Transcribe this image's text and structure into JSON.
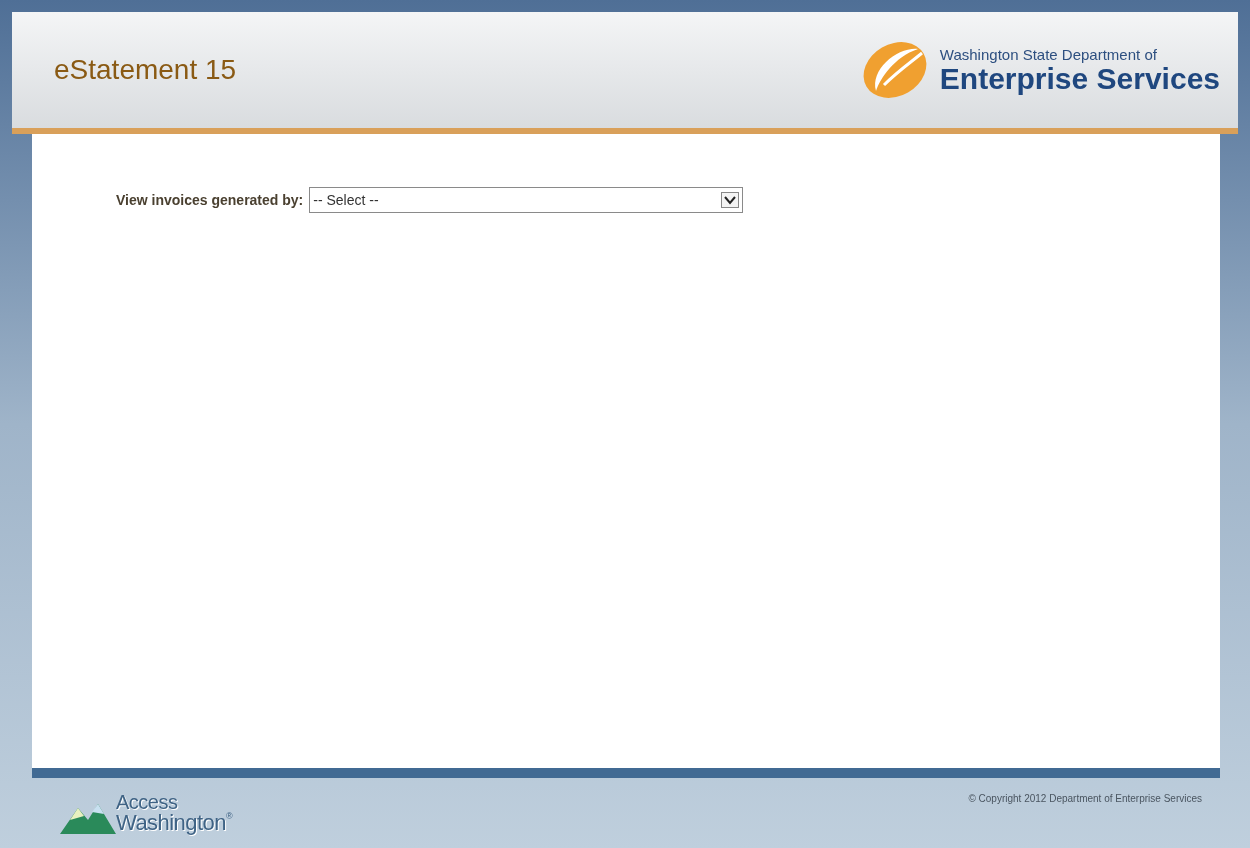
{
  "header": {
    "title": "eStatement 15",
    "logo": {
      "line_1": "Washington State Department of",
      "line_2": "Enterprise Services"
    }
  },
  "filter": {
    "label": "View invoices generated by:",
    "select_value": "-- Select --"
  },
  "footer": {
    "logo": {
      "line_1": "Access",
      "line_2": "Washington",
      "mark": "®"
    },
    "copyright": "© Copyright 2012 Department of Enterprise Services"
  }
}
